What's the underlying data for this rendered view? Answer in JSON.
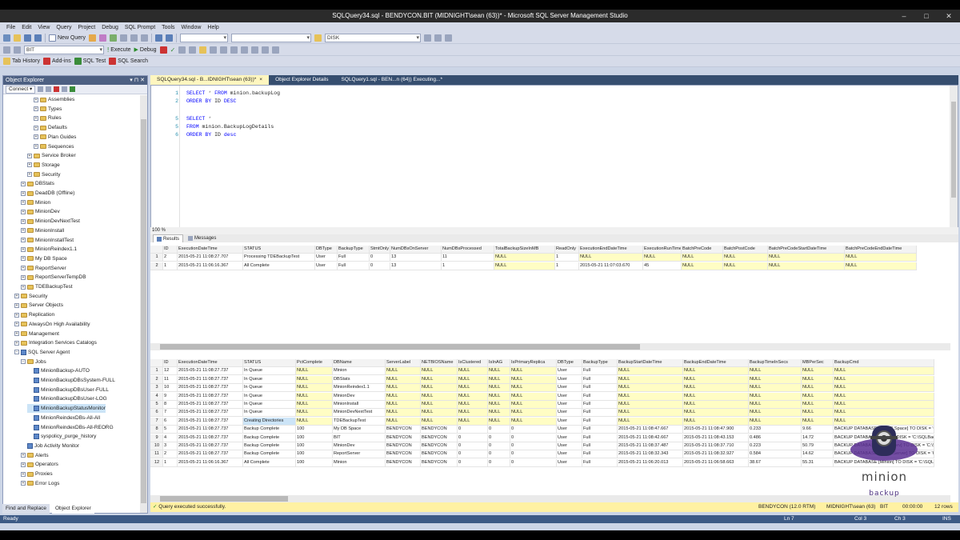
{
  "window": {
    "title": "SQLQuery34.sql - BENDYCON.BIT (MIDNIGHT\\sean (63))* - Microsoft SQL Server Management Studio"
  },
  "menu": [
    "File",
    "Edit",
    "View",
    "Query",
    "Project",
    "Debug",
    "SQL Prompt",
    "Tools",
    "Window",
    "Help"
  ],
  "toolbar": {
    "new_query": "New Query",
    "db_select": "BIT",
    "execute": "Execute",
    "debug": "Debug",
    "disk_select": "DISK",
    "tab_history": "Tab History",
    "add_ins": "Add-ins",
    "sql_test": "SQL Test",
    "sql_search": "SQL Search"
  },
  "object_explorer": {
    "title": "Object Explorer",
    "connect": "Connect ▾",
    "items": [
      {
        "label": "Assemblies",
        "indent": 3,
        "pm": "+",
        "icon": "folder"
      },
      {
        "label": "Types",
        "indent": 3,
        "pm": "+",
        "icon": "folder"
      },
      {
        "label": "Rules",
        "indent": 3,
        "pm": "+",
        "icon": "folder"
      },
      {
        "label": "Defaults",
        "indent": 3,
        "pm": "+",
        "icon": "folder"
      },
      {
        "label": "Plan Guides",
        "indent": 3,
        "pm": "+",
        "icon": "folder"
      },
      {
        "label": "Sequences",
        "indent": 3,
        "pm": "+",
        "icon": "folder"
      },
      {
        "label": "Service Broker",
        "indent": 2,
        "pm": "+",
        "icon": "folder"
      },
      {
        "label": "Storage",
        "indent": 2,
        "pm": "+",
        "icon": "folder"
      },
      {
        "label": "Security",
        "indent": 2,
        "pm": "+",
        "icon": "folder"
      },
      {
        "label": "DBStats",
        "indent": 1,
        "pm": "+",
        "icon": "db"
      },
      {
        "label": "DeadDB (Offline)",
        "indent": 1,
        "pm": "+",
        "icon": "db"
      },
      {
        "label": "Minion",
        "indent": 1,
        "pm": "+",
        "icon": "db"
      },
      {
        "label": "MinionDev",
        "indent": 1,
        "pm": "+",
        "icon": "db"
      },
      {
        "label": "MinionDevNextTest",
        "indent": 1,
        "pm": "+",
        "icon": "db"
      },
      {
        "label": "MinionInstall",
        "indent": 1,
        "pm": "+",
        "icon": "db"
      },
      {
        "label": "MinionInstallTest",
        "indent": 1,
        "pm": "+",
        "icon": "db"
      },
      {
        "label": "MinionReindex1.1",
        "indent": 1,
        "pm": "+",
        "icon": "db"
      },
      {
        "label": "My DB Space",
        "indent": 1,
        "pm": "+",
        "icon": "db"
      },
      {
        "label": "ReportServer",
        "indent": 1,
        "pm": "+",
        "icon": "db"
      },
      {
        "label": "ReportServerTempDB",
        "indent": 1,
        "pm": "+",
        "icon": "db"
      },
      {
        "label": "TDEBackupTest",
        "indent": 1,
        "pm": "+",
        "icon": "db"
      },
      {
        "label": "Security",
        "indent": 0,
        "pm": "+",
        "icon": "folder"
      },
      {
        "label": "Server Objects",
        "indent": 0,
        "pm": "+",
        "icon": "folder"
      },
      {
        "label": "Replication",
        "indent": 0,
        "pm": "+",
        "icon": "folder"
      },
      {
        "label": "AlwaysOn High Availability",
        "indent": 0,
        "pm": "+",
        "icon": "folder"
      },
      {
        "label": "Management",
        "indent": 0,
        "pm": "+",
        "icon": "folder"
      },
      {
        "label": "Integration Services Catalogs",
        "indent": 0,
        "pm": "+",
        "icon": "folder"
      },
      {
        "label": "SQL Server Agent",
        "indent": 0,
        "pm": "−",
        "icon": "agent"
      },
      {
        "label": "Jobs",
        "indent": 1,
        "pm": "−",
        "icon": "folder"
      },
      {
        "label": "MinionBackup-AUTO",
        "indent": 2,
        "pm": "",
        "icon": "job"
      },
      {
        "label": "MinionBackupDBsSystem-FULL",
        "indent": 2,
        "pm": "",
        "icon": "job"
      },
      {
        "label": "MinionBackupDBsUser-FULL",
        "indent": 2,
        "pm": "",
        "icon": "job"
      },
      {
        "label": "MinionBackupDBsUser-LOG",
        "indent": 2,
        "pm": "",
        "icon": "job"
      },
      {
        "label": "MinionBackupStatusMonitor",
        "indent": 2,
        "pm": "",
        "icon": "job",
        "selected": true
      },
      {
        "label": "MinionReindexDBs-All-All",
        "indent": 2,
        "pm": "",
        "icon": "job"
      },
      {
        "label": "MinionReindexDBs-All-REORG",
        "indent": 2,
        "pm": "",
        "icon": "job"
      },
      {
        "label": "syspolicy_purge_history",
        "indent": 2,
        "pm": "",
        "icon": "job"
      },
      {
        "label": "Job Activity Monitor",
        "indent": 1,
        "pm": "",
        "icon": "job"
      },
      {
        "label": "Alerts",
        "indent": 1,
        "pm": "+",
        "icon": "folder"
      },
      {
        "label": "Operators",
        "indent": 1,
        "pm": "+",
        "icon": "folder"
      },
      {
        "label": "Proxies",
        "indent": 1,
        "pm": "+",
        "icon": "folder"
      },
      {
        "label": "Error Logs",
        "indent": 1,
        "pm": "+",
        "icon": "folder"
      }
    ],
    "bottom_tabs": [
      "Find and Replace",
      "Object Explorer"
    ]
  },
  "doc_tabs": [
    {
      "label": "SQLQuery34.sql - B...IDNIGHT\\sean (63))*",
      "active": true,
      "close": "×"
    },
    {
      "label": "Object Explorer Details",
      "active": false,
      "close": ""
    },
    {
      "label": "SQLQuery1.sql - BEN...n (64)) Executing...*",
      "active": false,
      "close": ""
    }
  ],
  "editor": {
    "lines": [
      {
        "n": "1",
        "parts": [
          [
            "kw",
            "SELECT "
          ],
          [
            "gr",
            "* "
          ],
          [
            "kw",
            "FROM "
          ],
          [
            "",
            "minion.backupLog"
          ]
        ]
      },
      {
        "n": "2",
        "parts": [
          [
            "kw",
            "ORDER BY "
          ],
          [
            "",
            "ID "
          ],
          [
            "kw",
            "DESC"
          ]
        ]
      },
      {
        "n": "3",
        "parts": []
      },
      {
        "n": "4",
        "parts": []
      },
      {
        "n": "5",
        "parts": [
          [
            "kw",
            "SELECT "
          ],
          [
            "gr",
            "*"
          ]
        ]
      },
      {
        "n": "5",
        "parts": [
          [
            "kw",
            "FROM "
          ],
          [
            "",
            "minion.BackupLogDetails"
          ]
        ]
      },
      {
        "n": "6",
        "parts": [
          [
            "kw",
            "ORDER BY "
          ],
          [
            "",
            "ID "
          ],
          [
            "kw",
            "desc"
          ]
        ]
      }
    ],
    "zoom": "100 %"
  },
  "result_tabs": {
    "results": "Results",
    "messages": "Messages"
  },
  "grid1": {
    "columns": [
      "ID",
      "ExecutionDateTime",
      "STATUS",
      "DBType",
      "BackupType",
      "StmtOnly",
      "NumDBsOnServer",
      "NumDBsProcessed",
      "TotalBackupSizeInMB",
      "ReadOnly",
      "ExecutionEndDateTime",
      "ExecutionRunTimeInSecs",
      "BatchPreCode",
      "BatchPostCode",
      "BatchPreCodeStartDateTime",
      "BatchPreCodeEndDateTime"
    ],
    "rows": [
      [
        "1",
        "2",
        "2015-05-21 11:08:27.707",
        "Processing TDEBackupTest",
        "User",
        "Full",
        "0",
        "13",
        "11",
        "NULL",
        "1",
        "NULL",
        "NULL",
        "NULL",
        "NULL",
        "NULL",
        "NULL"
      ],
      [
        "2",
        "1",
        "2015-05-21 11:06:16.367",
        "All Complete",
        "User",
        "Full",
        "0",
        "13",
        "1",
        "NULL",
        "1",
        "2015-05-21 11:07:03.670",
        "45",
        "NULL",
        "NULL",
        "NULL",
        "NULL"
      ]
    ]
  },
  "grid2": {
    "columns": [
      "ID",
      "ExecutionDateTime",
      "STATUS",
      "PctComplete",
      "DBName",
      "ServerLabel",
      "NETBIOSName",
      "IsClustered",
      "IsInAG",
      "IsPrimaryReplica",
      "DBType",
      "BackupType",
      "BackupStartDateTime",
      "BackupEndDateTime",
      "BackupTimeInSecs",
      "MBPerSec",
      "BackupCmd"
    ],
    "rows": [
      [
        "1",
        "12",
        "2015-05-21 11:08:27.737",
        "In Queue",
        "NULL",
        "Minion",
        "NULL",
        "NULL",
        "NULL",
        "NULL",
        "NULL",
        "User",
        "Full",
        "NULL",
        "NULL",
        "NULL",
        "NULL",
        "NULL"
      ],
      [
        "2",
        "11",
        "2015-05-21 11:08:27.737",
        "In Queue",
        "NULL",
        "DBStats",
        "NULL",
        "NULL",
        "NULL",
        "NULL",
        "NULL",
        "User",
        "Full",
        "NULL",
        "NULL",
        "NULL",
        "NULL",
        "NULL"
      ],
      [
        "3",
        "10",
        "2015-05-21 11:08:27.737",
        "In Queue",
        "NULL",
        "MinionReindex1.1",
        "NULL",
        "NULL",
        "NULL",
        "NULL",
        "NULL",
        "User",
        "Full",
        "NULL",
        "NULL",
        "NULL",
        "NULL",
        "NULL"
      ],
      [
        "4",
        "9",
        "2015-05-21 11:08:27.737",
        "In Queue",
        "NULL",
        "MinionDev",
        "NULL",
        "NULL",
        "NULL",
        "NULL",
        "NULL",
        "User",
        "Full",
        "NULL",
        "NULL",
        "NULL",
        "NULL",
        "NULL"
      ],
      [
        "5",
        "8",
        "2015-05-21 11:08:27.737",
        "In Queue",
        "NULL",
        "MinionInstall",
        "NULL",
        "NULL",
        "NULL",
        "NULL",
        "NULL",
        "User",
        "Full",
        "NULL",
        "NULL",
        "NULL",
        "NULL",
        "NULL"
      ],
      [
        "6",
        "7",
        "2015-05-21 11:08:27.737",
        "In Queue",
        "NULL",
        "MinionDevNextTest",
        "NULL",
        "NULL",
        "NULL",
        "NULL",
        "NULL",
        "User",
        "Full",
        "NULL",
        "NULL",
        "NULL",
        "NULL",
        "NULL"
      ],
      [
        "7",
        "6",
        "2015-05-21 11:08:27.737",
        "Creating Directories",
        "NULL",
        "TDEBackupTest",
        "NULL",
        "NULL",
        "NULL",
        "NULL",
        "NULL",
        "User",
        "Full",
        "NULL",
        "NULL",
        "NULL",
        "NULL",
        "NULL"
      ],
      [
        "8",
        "5",
        "2015-05-21 11:08:27.737",
        "Backup Complete",
        "100",
        "My DB Space",
        "BENDYCON",
        "BENDYCON",
        "0",
        "0",
        "0",
        "User",
        "Full",
        "2015-05-21 11:08:47.667",
        "2015-05-21 11:08:47.900",
        "0.233",
        "9.66",
        "BACKUP DATABASE [My DB Space] TO DISK = 'C:\\SQLBackups\\..."
      ],
      [
        "9",
        "4",
        "2015-05-21 11:08:27.737",
        "Backup Complete",
        "100",
        "BIT",
        "BENDYCON",
        "BENDYCON",
        "0",
        "0",
        "0",
        "User",
        "Full",
        "2015-05-21 11:08:42.667",
        "2015-05-21 11:08:43.153",
        "0.486",
        "14.72",
        "BACKUP DATABASE [BIT] TO DISK = 'C:\\SQLBackups\\..."
      ],
      [
        "10",
        "3",
        "2015-05-21 11:08:27.737",
        "Backup Complete",
        "100",
        "MinionDev",
        "BENDYCON",
        "BENDYCON",
        "0",
        "0",
        "0",
        "User",
        "Full",
        "2015-05-21 11:08:37.487",
        "2015-05-21 11:08:37.710",
        "0.223",
        "50.79",
        "BACKUP DATABASE [MinionDev] TO DISK = 'C:\\SQLBackups\\..."
      ],
      [
        "11",
        "2",
        "2015-05-21 11:08:27.737",
        "Backup Complete",
        "100",
        "ReportServer",
        "BENDYCON",
        "BENDYCON",
        "0",
        "0",
        "0",
        "User",
        "Full",
        "2015-05-21 11:08:32.343",
        "2015-05-21 11:08:32.927",
        "0.584",
        "14.62",
        "BACKUP DATABASE [ReportServer] TO DISK = 'C:\\SQLBackups\\..."
      ],
      [
        "12",
        "1",
        "2015-05-21 11:06:16.367",
        "All Complete",
        "100",
        "Minion",
        "BENDYCON",
        "BENDYCON",
        "0",
        "0",
        "0",
        "User",
        "Full",
        "2015-05-21 11:06:20.013",
        "2015-05-21 11:06:58.663",
        "38.67",
        "55.31",
        "BACKUP DATABASE [Minion] TO DISK = 'C:\\SQLBackups\\..."
      ]
    ]
  },
  "status_bar": {
    "message": "Query executed successfully.",
    "server": "BENDYCON (12.0 RTM)",
    "user": "MIDNIGHT\\sean (63)",
    "db": "BIT",
    "time": "00:00:00",
    "rows": "12 rows"
  },
  "app_status": {
    "ready": "Ready",
    "ln": "Ln 7",
    "col": "Col 3",
    "ch": "Ch 3",
    "ins": "INS"
  },
  "logo": {
    "text": "minion",
    "sub": "backup"
  },
  "colors": {
    "accent": "#364e6f",
    "null_bg": "#fffdc4",
    "status_bg": "#fff1a3",
    "selected": "#cce4f7"
  }
}
